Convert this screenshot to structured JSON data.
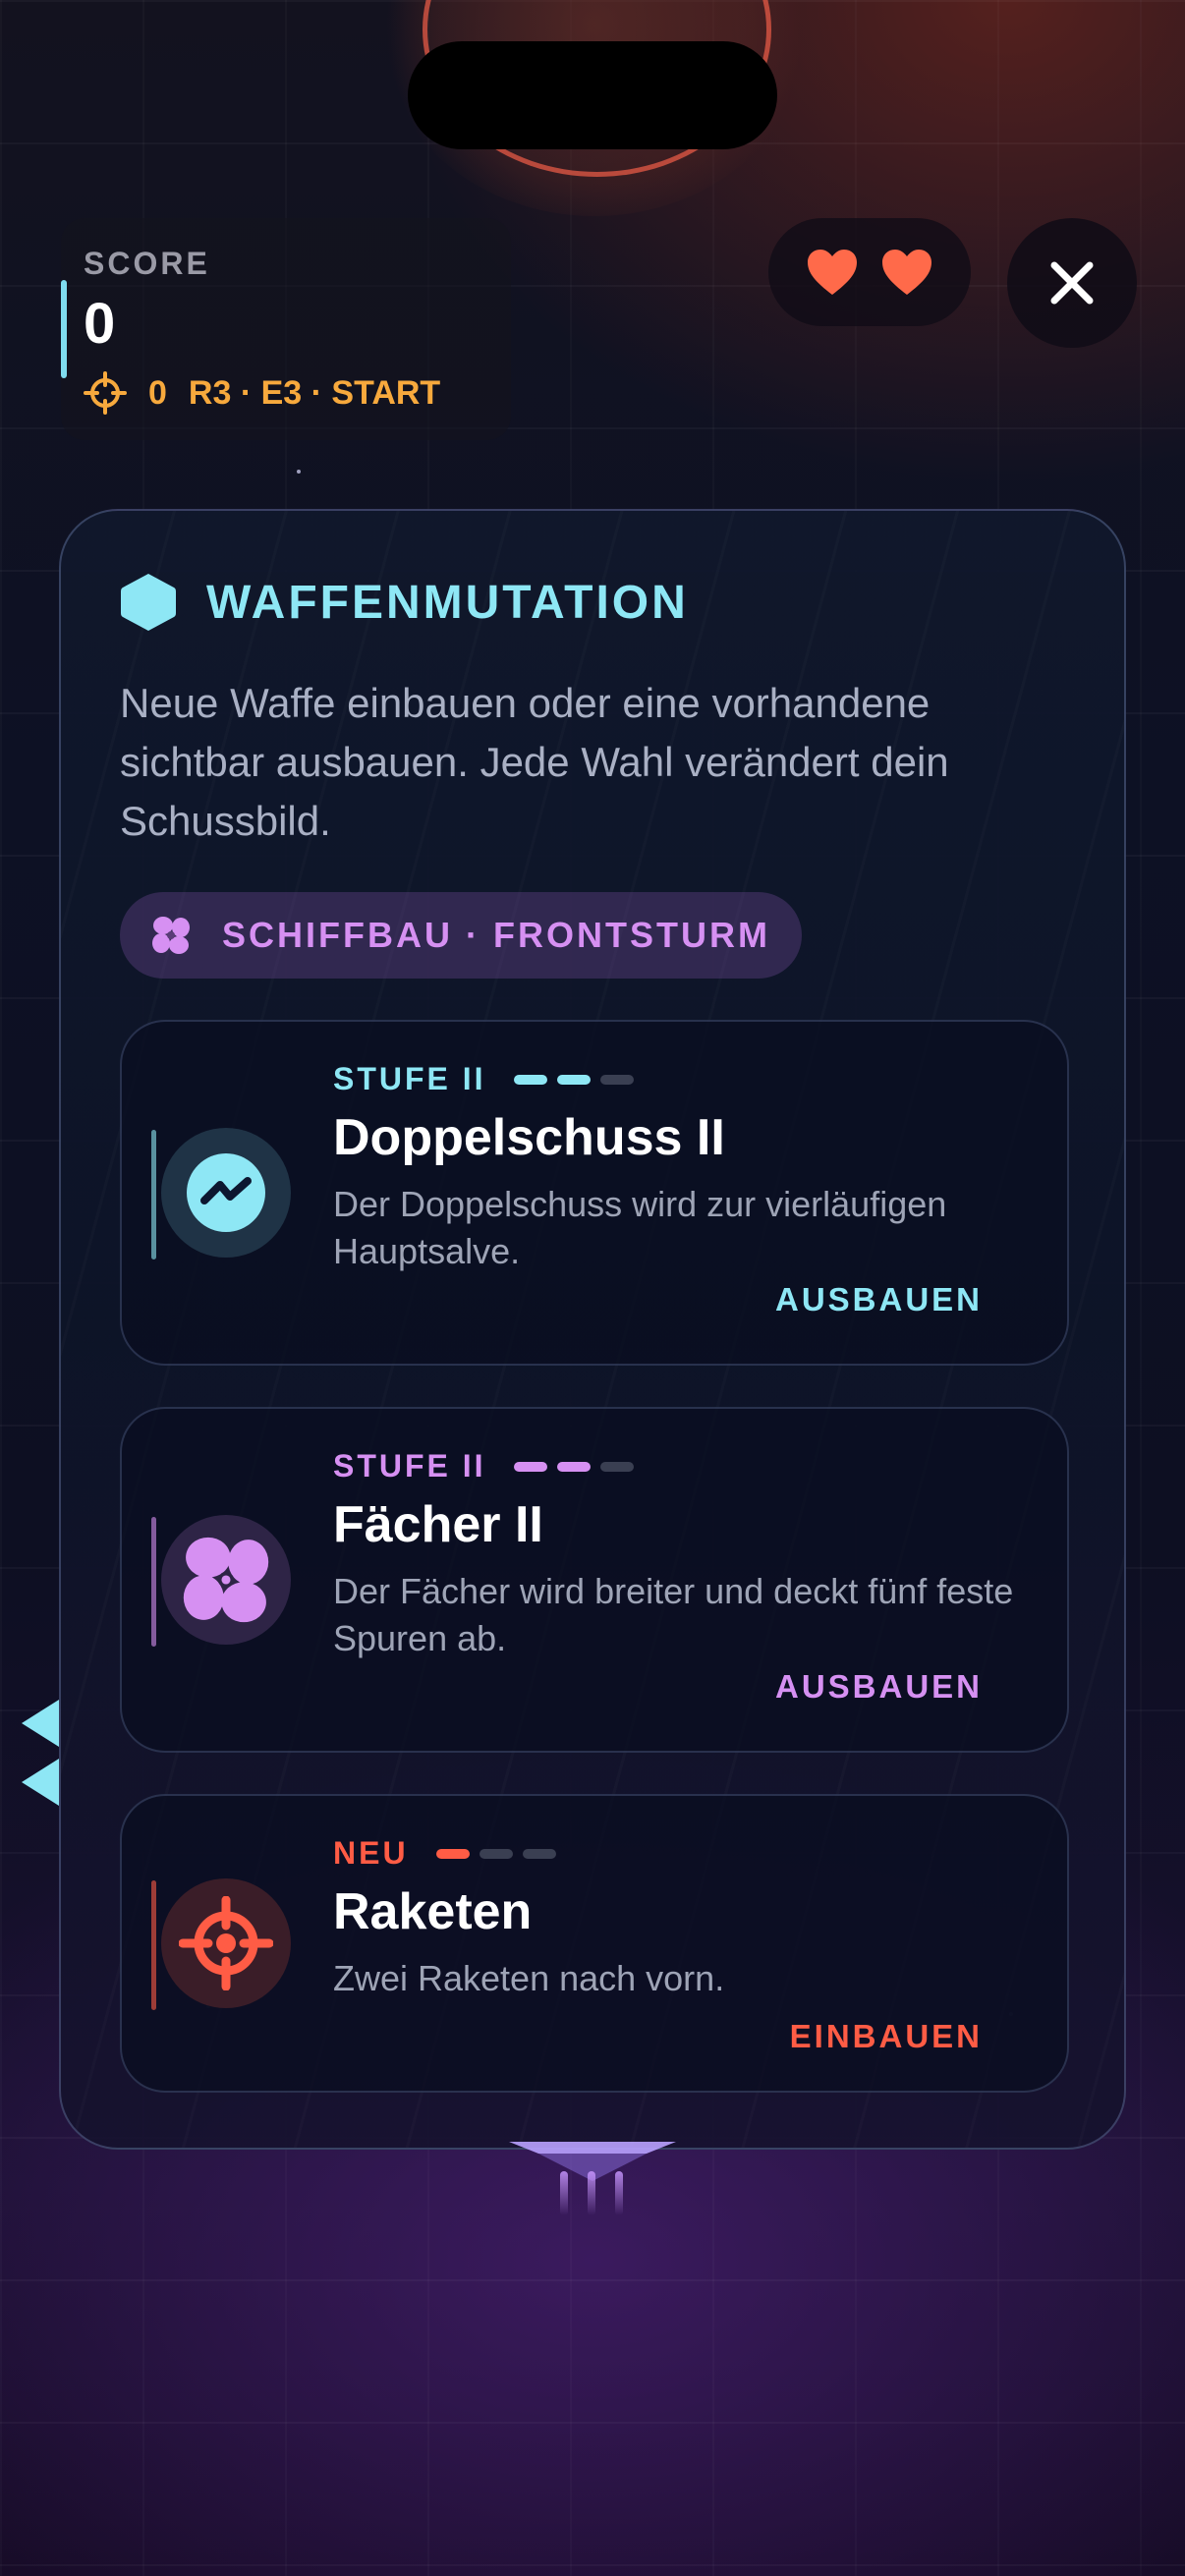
{
  "hud": {
    "score_label": "SCORE",
    "score_value": "0",
    "kills": "0",
    "stage": "R3 · E3 · START",
    "lives": 2
  },
  "panel": {
    "title": "WAFFENMUTATION",
    "description": "Neue Waffe einbauen oder eine vorhandene sichtbar ausbauen. Jede Wahl verändert dein Schussbild.",
    "chip": "SCHIFFBAU · FRONTSTURM"
  },
  "cards": [
    {
      "level": "STUFE II",
      "pips_filled": 2,
      "pips_total": 3,
      "name": "Doppelschuss II",
      "description": "Der Doppelschuss wird zur vierläufigen Hauptsalve.",
      "action": "AUSBAUEN",
      "color": "#8ee7f5",
      "icon": "wave-icon"
    },
    {
      "level": "STUFE II",
      "pips_filled": 2,
      "pips_total": 3,
      "name": "Fächer II",
      "description": "Der Fächer wird breiter und deckt fünf feste Spuren ab.",
      "action": "AUSBAUEN",
      "color": "#d690f2",
      "icon": "fan-icon"
    },
    {
      "level": "NEU",
      "pips_filled": 1,
      "pips_total": 3,
      "name": "Raketen",
      "description": "Zwei Raketen nach vorn.",
      "action": "EINBAUEN",
      "color": "#ff5c45",
      "icon": "crosshair-icon"
    }
  ],
  "colors": {
    "cyan": "#8ee7f5",
    "purple": "#d690f2",
    "red": "#ff5c45",
    "gold": "#f7a93d",
    "heart": "#ff6a4a"
  }
}
